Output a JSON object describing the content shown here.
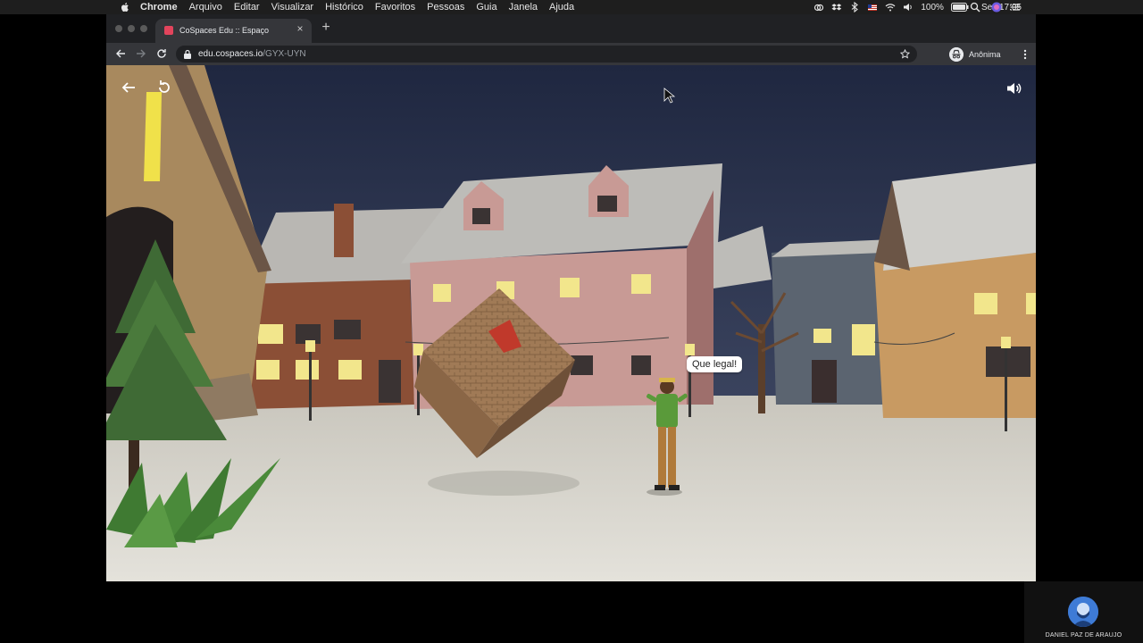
{
  "menubar": {
    "app_name": "Chrome",
    "items": [
      "Arquivo",
      "Editar",
      "Visualizar",
      "Histórico",
      "Favoritos",
      "Pessoas",
      "Guia",
      "Janela",
      "Ajuda"
    ],
    "battery": "100%",
    "clock": "Sex 17:05"
  },
  "browser": {
    "tab_title": "CoSpaces Edu :: Espaço",
    "url_host": "edu.cospaces.io",
    "url_path": "/GYX-UYN",
    "profile_label": "Anônima"
  },
  "scene": {
    "speech_bubble": "Que legal!"
  },
  "participant": {
    "name": "DANIEL PAZ DE ARAUJO"
  },
  "colors": {
    "sky": "#27304a",
    "snow": "#dcdad2",
    "cube": "#a07a56",
    "accent": "#e2445c",
    "participant_avatar": "#3e7bd6"
  }
}
